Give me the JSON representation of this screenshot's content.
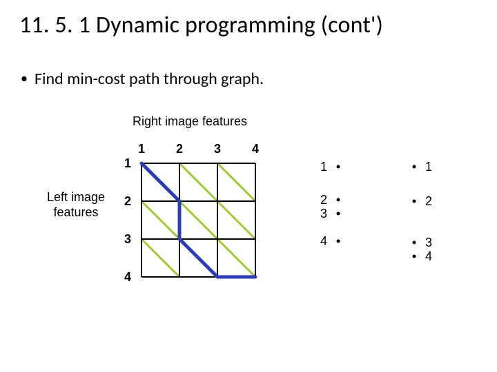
{
  "title": "11. 5. 1 Dynamic programming (cont')",
  "bullet": "Find min-cost path through graph.",
  "figure": {
    "top_caption": "Right image features",
    "left_caption_line1": "Left image",
    "left_caption_line2": "features",
    "col_labels": [
      "1",
      "2",
      "3",
      "4"
    ],
    "row_labels": [
      "1",
      "2",
      "3",
      "4"
    ],
    "right_left_labels": [
      "1",
      "2",
      "3",
      "4"
    ],
    "right_right_labels": [
      "1",
      "2",
      "3",
      "4"
    ]
  },
  "chart_data": {
    "type": "other",
    "description": "Dynamic programming cost grid for stereo matching between left-image features (rows 1-4) and right-image features (columns 1-4), with an example min-cost path highlighted, and a correspondence diagram mapping left features {1,2,3,4} to right features {1,2,3,4}.",
    "grid": {
      "rows": 4,
      "cols": 4,
      "row_axis": "Left image features",
      "col_axis": "Right image features"
    },
    "highlighted_path_cells": [
      {
        "row": 1,
        "col": 1,
        "move": "diag"
      },
      {
        "row": 2,
        "col": 2,
        "move": "down"
      },
      {
        "row": 3,
        "col": 2,
        "move": "diag"
      },
      {
        "row": 4,
        "col": 3,
        "move": "diag"
      }
    ],
    "correspondences": [
      {
        "left_feature": 1,
        "right_feature": 1
      },
      {
        "left_feature": 2,
        "right_feature": 2
      },
      {
        "left_feature": 3,
        "right_feature": 2
      },
      {
        "left_feature": 4,
        "right_feature": 3
      },
      {
        "left_feature": 4,
        "right_feature": 4
      }
    ]
  }
}
